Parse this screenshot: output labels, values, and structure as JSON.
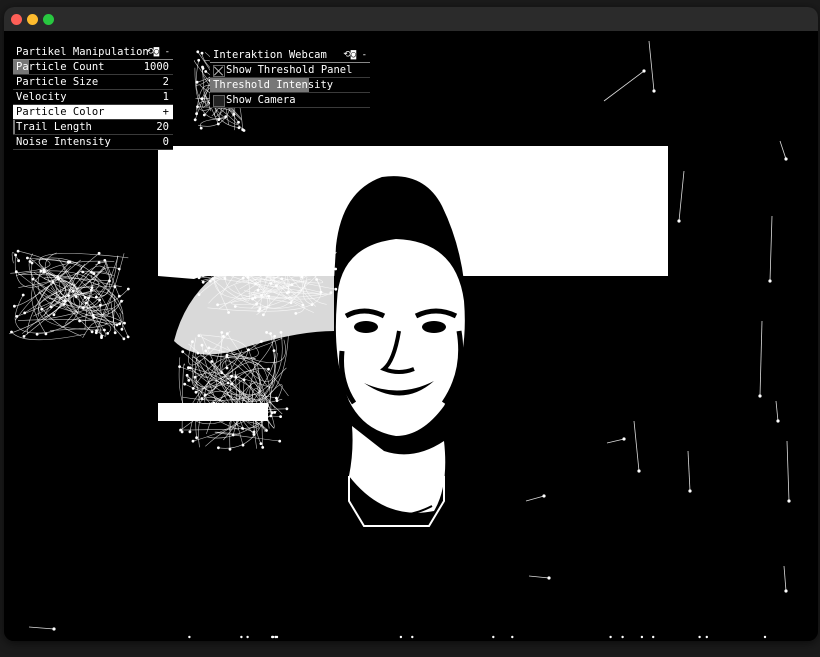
{
  "window": {
    "controls": [
      "close-button",
      "minimize-button",
      "zoom-button"
    ]
  },
  "panel_particles": {
    "title": "Partikel Manipulation",
    "controls_glyph": "⟲◙ -",
    "rows": [
      {
        "label": "Particle Count",
        "value": "1000",
        "fill": 0.1
      },
      {
        "label": "Particle Size",
        "value": "2",
        "fill": 0
      },
      {
        "label": "Velocity",
        "value": "1",
        "fill": 0
      },
      {
        "label": "Particle Color",
        "value": "+"
      },
      {
        "label": "Trail Length",
        "value": "20",
        "fill": 0.01
      },
      {
        "label": "Noise Intensity",
        "value": "0",
        "fill": 0
      }
    ]
  },
  "panel_webcam": {
    "title": "Interaktion Webcam",
    "controls_glyph": "⟲◙ -",
    "show_threshold_label": "Show Threshold Panel",
    "show_threshold_checked": true,
    "threshold_label": "Threshold Intensity",
    "threshold_fill": 0.62,
    "show_camera_label": "Show Camera",
    "show_camera_checked": false
  },
  "colors": {
    "background": "#000000",
    "foreground": "#ffffff",
    "slider_fill": "#777777"
  }
}
